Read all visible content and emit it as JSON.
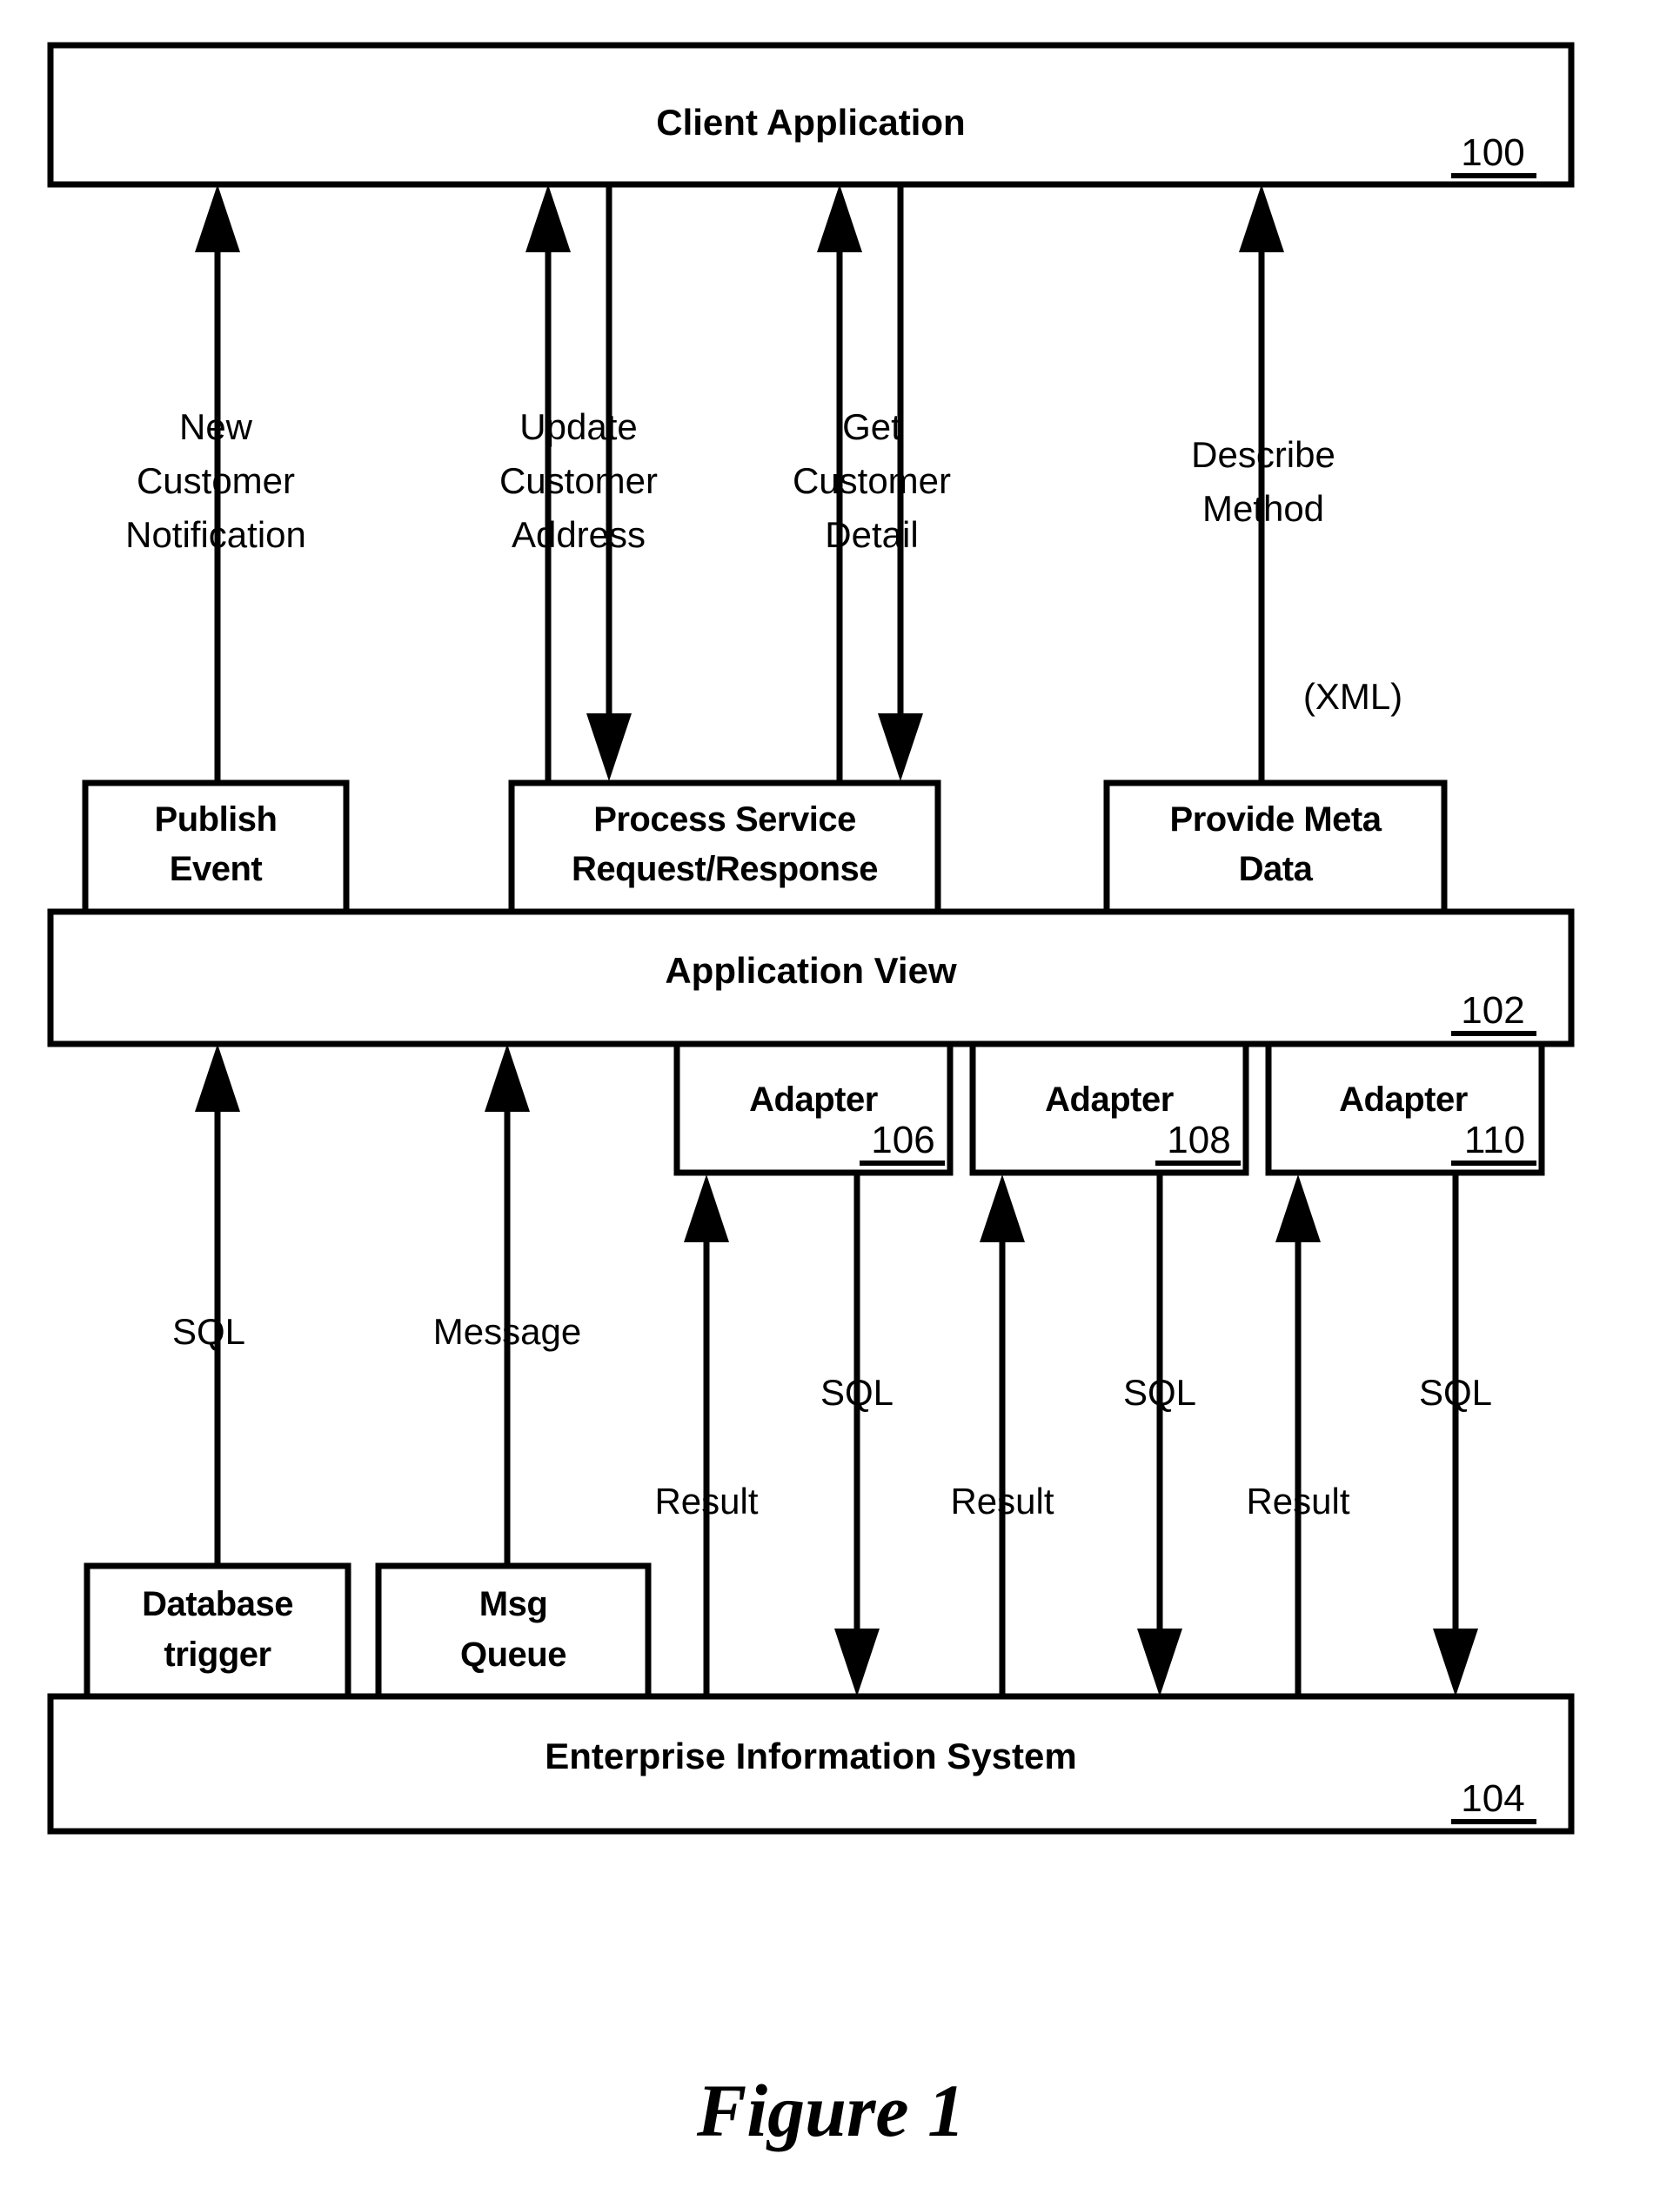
{
  "figure": {
    "caption": "Figure 1"
  },
  "nodes": {
    "client_application": {
      "label": "Client Application",
      "ref": "100"
    },
    "publish_event": {
      "line1": "Publish",
      "line2": "Event"
    },
    "process_service": {
      "line1": "Process Service",
      "line2": "Request/Response"
    },
    "provide_meta_data": {
      "line1": "Provide Meta",
      "line2": "Data"
    },
    "application_view": {
      "label": "Application View",
      "ref": "102"
    },
    "adapter_106": {
      "label": "Adapter",
      "ref": "106"
    },
    "adapter_108": {
      "label": "Adapter",
      "ref": "108"
    },
    "adapter_110": {
      "label": "Adapter",
      "ref": "110"
    },
    "database_trigger": {
      "line1": "Database",
      "line2": "trigger"
    },
    "msg_queue": {
      "line1": "Msg",
      "line2": "Queue"
    },
    "enterprise_information_system": {
      "label": "Enterprise Information System",
      "ref": "104"
    }
  },
  "edge_labels": {
    "new_customer_notification": {
      "line1": "New",
      "line2": "Customer",
      "line3": "Notification"
    },
    "update_customer_address": {
      "line1": "Update",
      "line2": "Customer",
      "line3": "Address"
    },
    "get_customer_detail": {
      "line1": "Get",
      "line2": "Customer",
      "line3": "Detail"
    },
    "describe_method": {
      "line1": "Describe",
      "line2": "Method"
    },
    "xml": "(XML)",
    "sql_db_trigger": "SQL",
    "message_queue": "Message",
    "result_106": "Result",
    "sql_106": "SQL",
    "result_108": "Result",
    "sql_108": "SQL",
    "result_110": "Result",
    "sql_110": "SQL"
  },
  "colors": {
    "stroke": "#000000",
    "fill": "#ffffff",
    "background": "#ffffff"
  }
}
